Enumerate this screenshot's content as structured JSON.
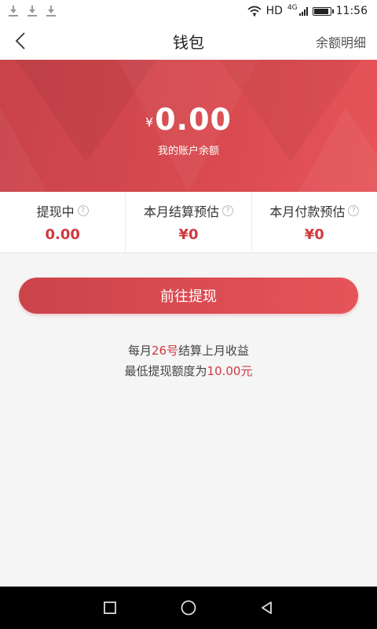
{
  "status_bar": {
    "hd": "HD",
    "network": "4G",
    "time": "11:56",
    "icons": [
      "download-icon",
      "download-icon",
      "download-icon",
      "wifi-icon",
      "signal-icon",
      "battery-icon"
    ]
  },
  "header": {
    "title": "钱包",
    "detail_link": "余额明细",
    "back_icon": "back-arrow-icon"
  },
  "balance": {
    "currency": "¥",
    "amount": "0.00",
    "label": "我的账户余额"
  },
  "stats": [
    {
      "title": "提现中",
      "value": "0.00"
    },
    {
      "title": "本月结算预估",
      "value": "¥0"
    },
    {
      "title": "本月付款预估",
      "value": "¥0"
    }
  ],
  "help_icon_glyph": "?",
  "withdraw_button": "前往提现",
  "notes": {
    "line1_prefix": "每月",
    "line1_highlight": "26号",
    "line1_suffix": "结算上月收益",
    "line2_prefix": "最低提现额度为",
    "line2_highlight": "10.00元"
  },
  "colors": {
    "brand_red": "#d84a50",
    "value_red": "#d0393f",
    "background": "#f5f5f5"
  }
}
